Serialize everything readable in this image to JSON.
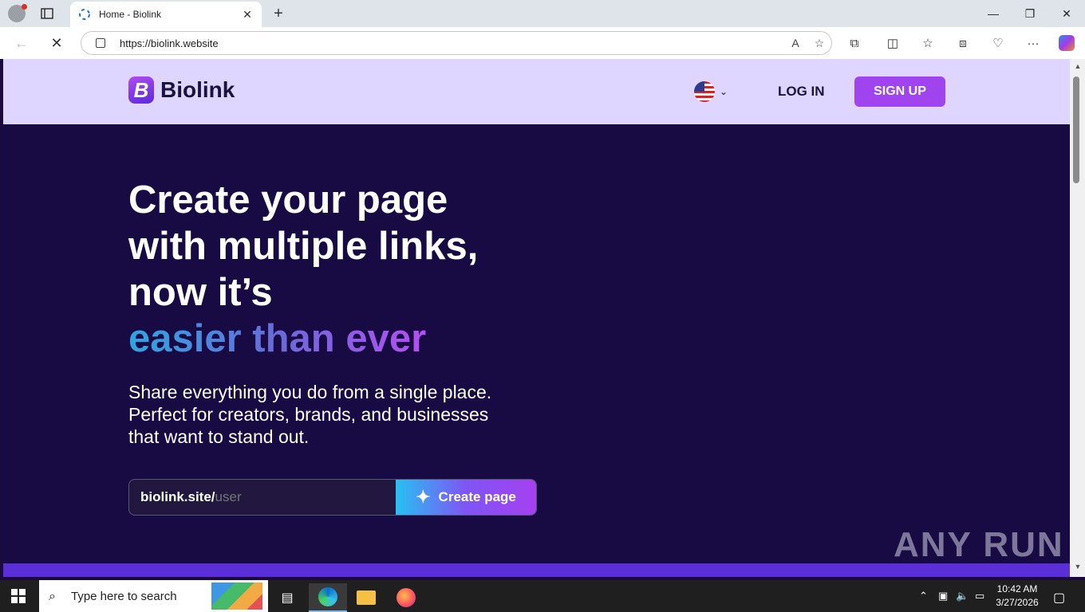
{
  "browser": {
    "tab_title": "Home - Biolink",
    "url": "https://biolink.website"
  },
  "site": {
    "logo_letter": "B",
    "logo_text": "Biolink",
    "login_label": "LOG IN",
    "signup_label": "SIGN UP",
    "language_flag": "us-flag-icon"
  },
  "hero": {
    "headline_line1": "Create your page",
    "headline_line2": "with multiple links,",
    "headline_line3": "now it’s",
    "headline_accent": "easier than ever",
    "subtext_line1": "Share everything you do from a single place.",
    "subtext_line2": "Perfect for creators, brands, and businesses",
    "subtext_line3": "that want to stand out.",
    "prefix": "biolink.site/",
    "username_placeholder": "user",
    "create_button_label": "Create page"
  },
  "watermark": "ANY RUN",
  "taskbar": {
    "search_placeholder": "Type here to search",
    "time": "10:42 AM",
    "date": "3/27/2026"
  },
  "colors": {
    "header_bg": "#ded6fe",
    "hero_bg": "#180b44",
    "signup_bg": "#a044f0",
    "accent_gradient_start": "#2fa6e0",
    "accent_gradient_end": "#b44ff0"
  }
}
